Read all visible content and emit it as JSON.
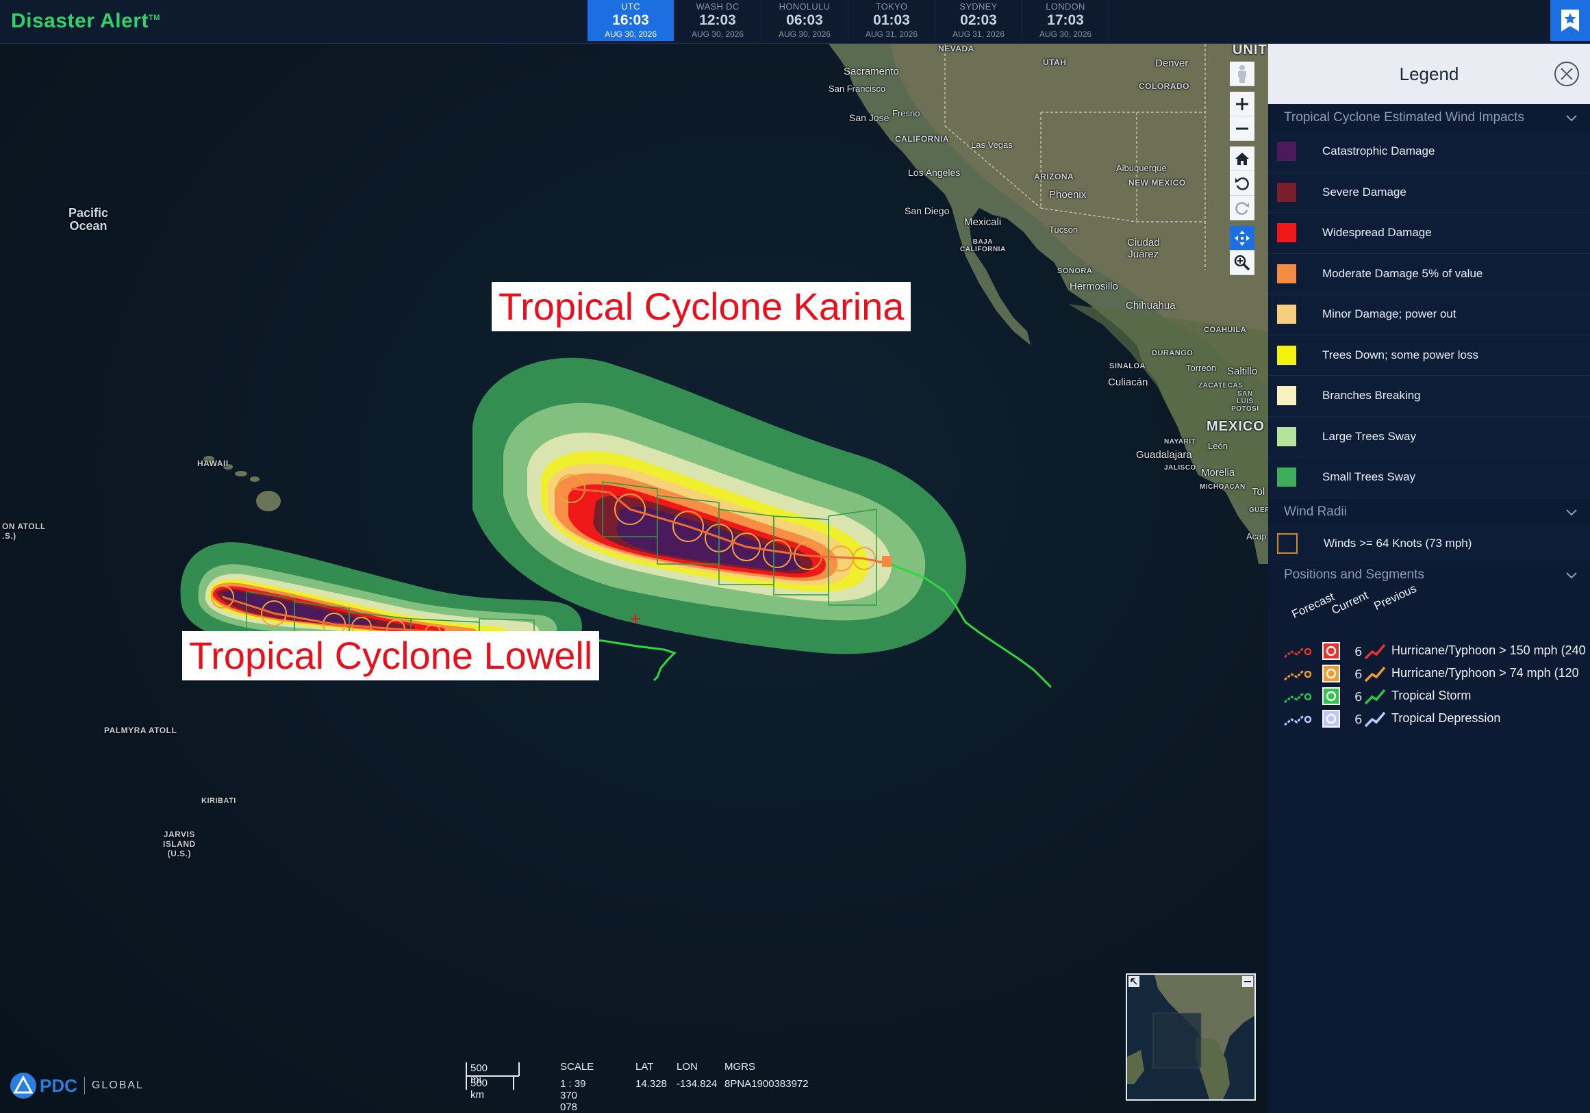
{
  "app": {
    "brand": "Disaster Alert",
    "trademark": "TM"
  },
  "clocks": [
    {
      "name": "UTC",
      "time": "16:03",
      "date": "AUG 30, 2026",
      "active": true
    },
    {
      "name": "WASH DC",
      "time": "12:03",
      "date": "AUG 30, 2026",
      "active": false
    },
    {
      "name": "HONOLULU",
      "time": "06:03",
      "date": "AUG 30, 2026",
      "active": false
    },
    {
      "name": "TOKYO",
      "time": "01:03",
      "date": "AUG 31, 2026",
      "active": false
    },
    {
      "name": "SYDNEY",
      "time": "02:03",
      "date": "AUG 31, 2026",
      "active": false
    },
    {
      "name": "LONDON",
      "time": "17:03",
      "date": "AUG 30, 2026",
      "active": false
    }
  ],
  "map": {
    "cyclone_labels": {
      "karina": "Tropical Cyclone Karina",
      "lowell": "Tropical Cyclone Lowell"
    },
    "places": {
      "nevada": "NEVADA",
      "utah": "UTAH",
      "united": "UNIT",
      "denver": "Denver",
      "colorado": "COLORADO",
      "sacramento": "Sacramento",
      "san_francisco": "San Francisco",
      "fresno": "Fresno",
      "san_jose": "San Jose",
      "california": "CALIFORNIA",
      "las_vegas": "Las Vegas",
      "los_angeles": "Los Angeles",
      "arizona": "ARIZONA",
      "albuquerque": "Albuquerque",
      "new_mexico": "NEW MEXICO",
      "phoenix": "Phoenix",
      "san_diego": "San Diego",
      "mexicali": "Mexicali",
      "baja_california": "BAJA\nCALIFORNIA",
      "tucson": "Tucson",
      "ciudad_juarez": "Ciudad\nJuárez",
      "sonora": "SONORA",
      "hermosillo": "Hermosillo",
      "chihuahua": "Chihuahua",
      "coahuila": "COAHUILA",
      "durango": "DURANGO",
      "sinaloa": "SINALOA",
      "torreon": "Torreón",
      "saltillo": "Saltillo",
      "culiacan": "Culiacán",
      "zacatecas": "ZACATECAS",
      "san_luis_potosi": "SAN\nLUIS\nPOTOSÍ",
      "mexico": "MEXICO",
      "nayarit": "NAYARIT",
      "leon": "León",
      "guadalajara": "Guadalajara",
      "jalisco": "JALISCO",
      "morelia": "Morelia",
      "michoacan": "MICHOACÁN",
      "tol": "Tol",
      "guerr": "GUERR",
      "acap": "Acap",
      "pacific_ocean": "Pacific\nOcean",
      "hawaii": "HAWAII",
      "johnston_atoll": "ON ATOLL\n.S.)",
      "palmyra_atoll": "PALMYRA ATOLL",
      "kiribati": "KIRIBATI",
      "jarvis_island": "JARVIS\nISLAND\n(U.S.)"
    }
  },
  "legend": {
    "title": "Legend",
    "sections": {
      "wind_impacts": "Tropical Cyclone Estimated Wind Impacts",
      "wind_radii": "Wind Radii",
      "positions": "Positions and Segments"
    },
    "wind_impacts": [
      {
        "label": "Catastrophic Damage",
        "color": "#4a1a5c"
      },
      {
        "label": "Severe Damage",
        "color": "#7a1e2e"
      },
      {
        "label": "Widespread Damage",
        "color": "#f01818"
      },
      {
        "label": "Moderate Damage 5% of value",
        "color": "#f58a42"
      },
      {
        "label": "Minor Damage; power out",
        "color": "#f7ce7e"
      },
      {
        "label": "Trees Down; some power loss",
        "color": "#f4f10e"
      },
      {
        "label": "Branches Breaking",
        "color": "#f8f0c0"
      },
      {
        "label": "Large Trees Sway",
        "color": "#b5e39c"
      },
      {
        "label": "Small Trees Sway",
        "color": "#3fae5c"
      }
    ],
    "wind_radii": {
      "label": "Winds >= 64 Knots (73 mph)",
      "color": "#d98a1c"
    },
    "positions": {
      "headers": {
        "forecast": "Forecast",
        "current": "Current",
        "previous": "Previous"
      },
      "rows": [
        {
          "label": "Hurricane/Typhoon > 150 mph (240",
          "color": "#e8322a"
        },
        {
          "label": "Hurricane/Typhoon > 74 mph (120",
          "color": "#f29a2e"
        },
        {
          "label": "Tropical Storm",
          "color": "#2fc44a"
        },
        {
          "label": "Tropical Depression",
          "color": "#b9c9ff"
        }
      ]
    }
  },
  "status": {
    "scale_mi": "500 mi",
    "scale_km": "500 km",
    "scale_head": "SCALE",
    "scale_val": "1 : 39 370 078",
    "lat_head": "LAT",
    "lat_val": "14.328",
    "lon_head": "LON",
    "lon_val": "-134.824",
    "mgrs_head": "MGRS",
    "mgrs_val": "8PNA1900383972"
  },
  "logo": {
    "text": "PDC",
    "sub": "GLOBAL"
  }
}
